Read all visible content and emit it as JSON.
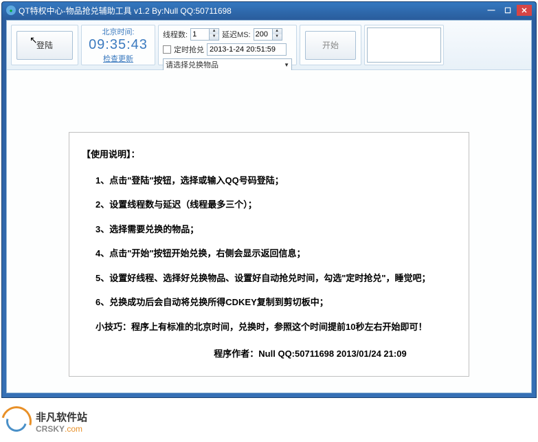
{
  "titlebar": {
    "icon_label": "app-icon",
    "text": "QT特权中心-物品抢兑辅助工具 v1.2   By:Null   QQ:50711698"
  },
  "toolbar": {
    "login_label": "登陆",
    "time_label": "北京时间:",
    "time_value": "09:35:43",
    "update_link": "检查更新",
    "threads_label": "线程数:",
    "threads_value": "1",
    "delay_label": "延迟MS:",
    "delay_value": "200",
    "scheduled_label": "定时抢兑",
    "scheduled_time": "2013-1-24 20:51:59",
    "select_placeholder": "请选择兑换物品",
    "start_label": "开始"
  },
  "instructions": {
    "title": "【使用说明】：",
    "items": [
      "1、点击\"登陆\"按钮，选择或输入QQ号码登陆；",
      "2、设置线程数与延迟（线程最多三个）；",
      "3、选择需要兑换的物品；",
      "4、点击\"开始\"按钮开始兑换，右侧会显示返回信息；",
      "5、设置好线程、选择好兑换物品、设置好自动抢兑时间，勾选\"定时抢兑\"，睡觉吧；",
      "6、兑换成功后会自动将兑换所得CDKEY复制到剪切板中；"
    ],
    "tip": "小技巧：程序上有标准的北京时间，兑换时，参照这个时间提前10秒左右开始即可！",
    "footer": "程序作者：Null      QQ:50711698      2013/01/24  21:09"
  },
  "watermark": {
    "cn": "非凡软件站",
    "en_pre": "CRSKY",
    "en_suf": ".com"
  }
}
